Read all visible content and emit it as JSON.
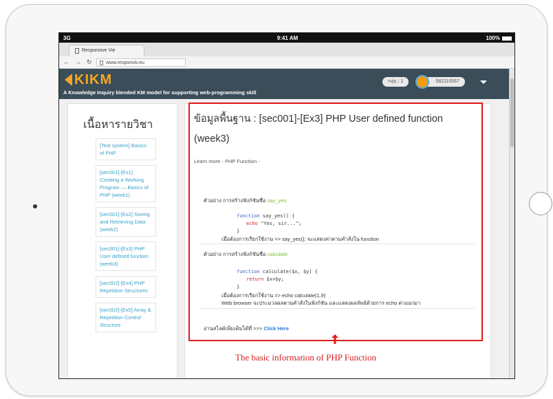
{
  "status_bar": {
    "signal": "3G",
    "time": "9:41 AM",
    "battery": "100%"
  },
  "browser": {
    "tab_title": "Responsive Vie",
    "url": "www.responsiv.eu"
  },
  "site_header": {
    "logo_text": "KIKM",
    "tagline": "A Knowledge Inquiry blended KM model for supporting web-programming skill",
    "group_label": "กลุ่ม : 1",
    "user_id": "582110067",
    "accent_color": "#f5a623",
    "bar_color": "#3a4d58"
  },
  "sidebar": {
    "title": "เนื้อหารายวิชา",
    "items": [
      "[Test system] Basics of PHP",
      "[sec001]-[Ex1] Creating a Working Program — Basics of PHP (week1)",
      "[sec001]-[Ex2] Saving and Retrieving Data (week2)",
      "[sec001]-[Ex3] PHP User defined function (week3)",
      "[sec002]-[Ex4] PHP Repetition Structures",
      "[sec002]-[Ex5] Array & Repetition Control Structure"
    ]
  },
  "content": {
    "title_line1": "ข้อมูลพื้นฐาน : [sec001]-[Ex3] PHP User defined function",
    "title_line2": "(week3)",
    "learn_more": "Learn more - PHP Function -",
    "example1": {
      "heading_prefix": "ตัวอย่าง การสร้างฟังก์ชันชื่อ",
      "heading_name": "say_yes",
      "code_line1_kw": "function",
      "code_line1_rest": " say_yes() {",
      "code_line2_kw": "echo",
      "code_line2_str": " \"Yes, sir...\";",
      "code_line3": "}",
      "desc": "เมื่อต้องการเรียกใช้งาน =>  say_yes();  จะแสดงค่าตามคำสั่งใน function"
    },
    "example2": {
      "heading_prefix": "ตัวอย่าง การสร้างฟังก์ชันชื่อ",
      "heading_name": "calculate",
      "code_line1_kw": "function",
      "code_line1_rest": " calculate($x, $y) {",
      "code_line2_kw": "return",
      "code_line2_rest": " $x+$y;",
      "code_line3": "}",
      "desc1": "เมื่อต้องการเรียกใช้งาน => echo calculate(1,9)",
      "desc2": "Web browser จะประมวลผลตามคำสั่งในฟังก์ชัน และแสดงผลลัพธ์ด้วยการ echo ค่าออกมา"
    },
    "read_more_prefix": "อ่านสไลด์เพิ่มเติมได้ที่ >>>",
    "read_more_link": "Click Here"
  },
  "annotation": {
    "caption": "The basic information  of PHP Function",
    "color": "#e01a1a"
  }
}
